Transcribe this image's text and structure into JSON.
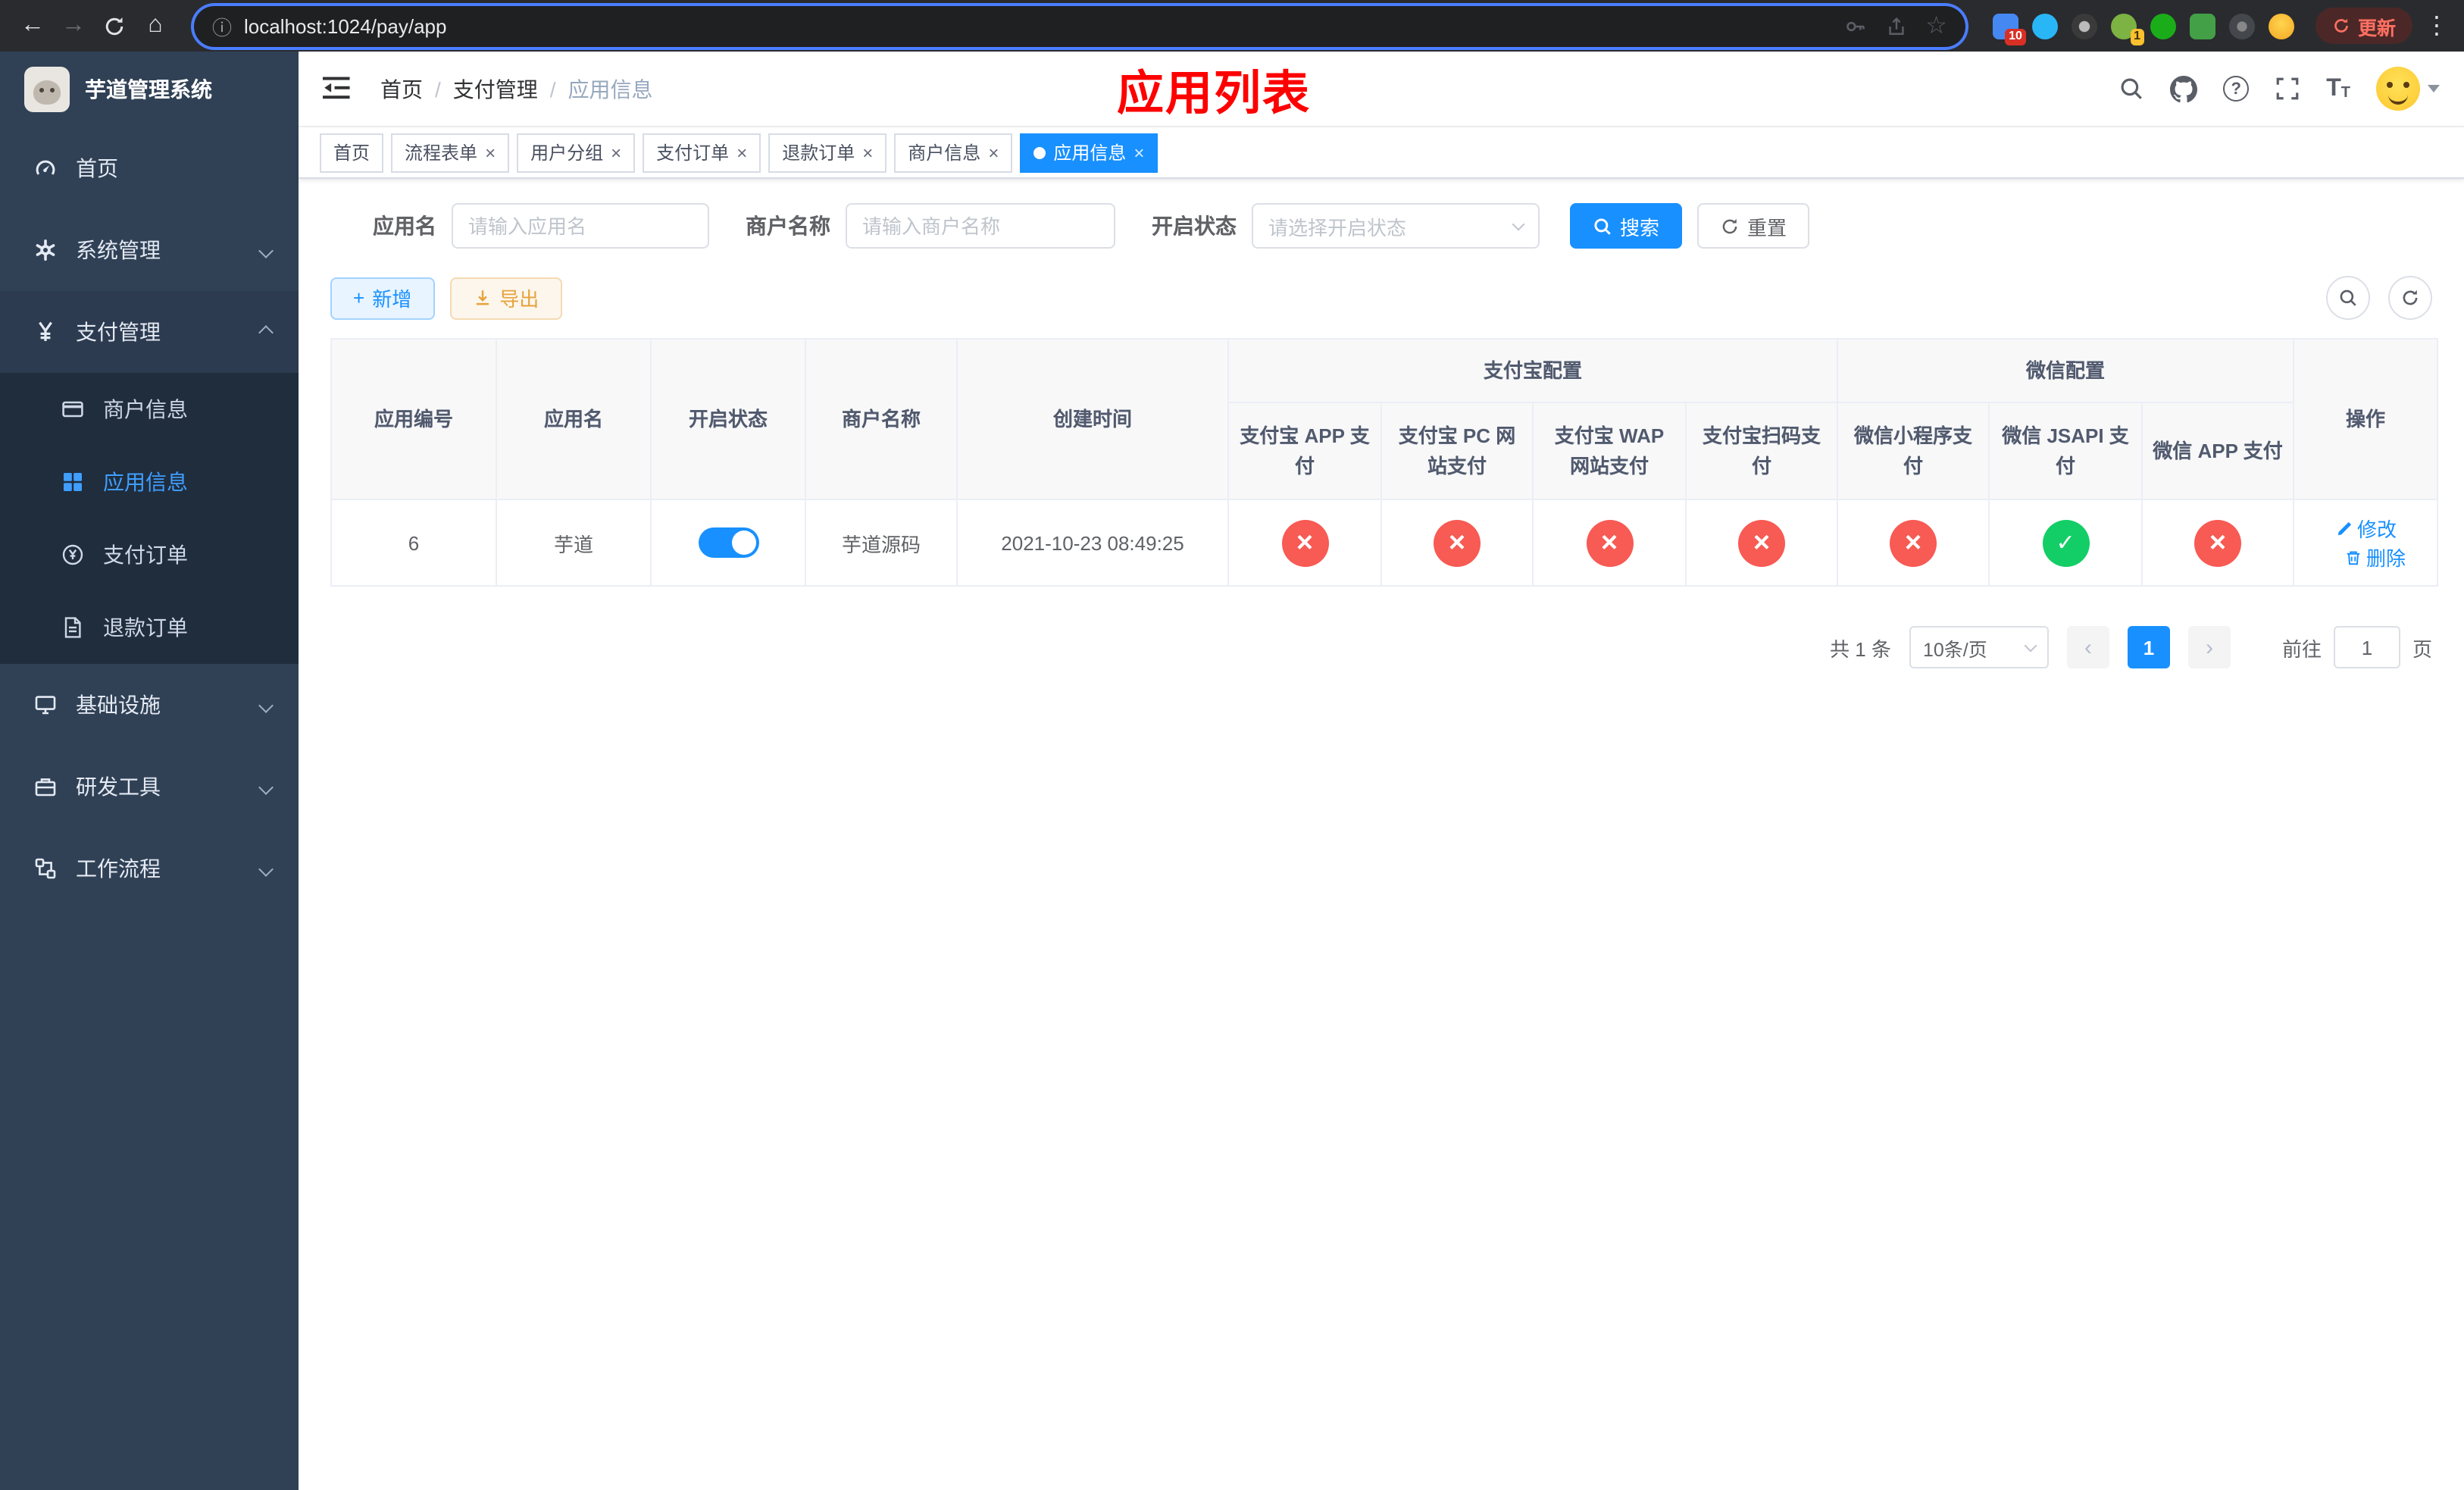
{
  "browser": {
    "url": "localhost:1024/pay/app",
    "update_label": "更新",
    "ext_badge_1": "10",
    "ext_badge_2": "1"
  },
  "icons": {
    "back": "←",
    "forward": "→",
    "home": "⌂",
    "info": "ⓘ",
    "star": "☆",
    "menu_dots": "⋮",
    "question": "?",
    "plus": "+",
    "close": "×",
    "check": "✓",
    "cross": "×",
    "separator": "/",
    "prev": "‹",
    "next": "›"
  },
  "sidebar": {
    "title": "芋道管理系统",
    "menu": [
      {
        "label": "首页"
      },
      {
        "label": "系统管理"
      },
      {
        "label": "支付管理"
      },
      {
        "label": "基础设施"
      },
      {
        "label": "研发工具"
      },
      {
        "label": "工作流程"
      }
    ],
    "submenu": [
      {
        "label": "商户信息"
      },
      {
        "label": "应用信息",
        "active": true
      },
      {
        "label": "支付订单"
      },
      {
        "label": "退款订单"
      }
    ]
  },
  "header": {
    "breadcrumb": [
      "首页",
      "支付管理",
      "应用信息"
    ],
    "page_title": "应用列表"
  },
  "tabs": [
    {
      "label": "首页",
      "closable": false,
      "active": false
    },
    {
      "label": "流程表单",
      "closable": true,
      "active": false
    },
    {
      "label": "用户分组",
      "closable": true,
      "active": false
    },
    {
      "label": "支付订单",
      "closable": true,
      "active": false
    },
    {
      "label": "退款订单",
      "closable": true,
      "active": false
    },
    {
      "label": "商户信息",
      "closable": true,
      "active": false
    },
    {
      "label": "应用信息",
      "closable": true,
      "active": true
    }
  ],
  "filters": {
    "app_name_label": "应用名",
    "app_name_placeholder": "请输入应用名",
    "merchant_label": "商户名称",
    "merchant_placeholder": "请输入商户名称",
    "status_label": "开启状态",
    "status_placeholder": "请选择开启状态",
    "search_label": "搜索",
    "reset_label": "重置"
  },
  "toolbar": {
    "add_label": "新增",
    "export_label": "导出"
  },
  "table": {
    "headers": {
      "app_id": "应用编号",
      "app_name": "应用名",
      "status": "开启状态",
      "merchant": "商户名称",
      "created": "创建时间",
      "alipay_group": "支付宝配置",
      "wechat_group": "微信配置",
      "actions": "操作",
      "sub": [
        "支付宝 APP 支付",
        "支付宝 PC 网站支付",
        "支付宝 WAP 网站支付",
        "支付宝扫码支付",
        "微信小程序支付",
        "微信 JSAPI 支付",
        "微信 APP 支付"
      ]
    },
    "rows": [
      {
        "app_id": "6",
        "app_name": "芋道",
        "enabled": true,
        "merchant": "芋道源码",
        "created": "2021-10-23 08:49:25",
        "configs": [
          false,
          false,
          false,
          false,
          false,
          true,
          false
        ],
        "edit_label": "修改",
        "delete_label": "删除"
      }
    ]
  },
  "pagination": {
    "total": "共 1 条",
    "page_size": "10条/页",
    "current_page": "1",
    "goto_label": "前往",
    "goto_value": "1",
    "page_suffix": "页"
  },
  "colors": {
    "primary": "#1890ff",
    "danger": "#f85a54",
    "success": "#13ce66",
    "warning": "#e6a23c",
    "sidebar": "#304156",
    "title_red": "#fe0000"
  }
}
